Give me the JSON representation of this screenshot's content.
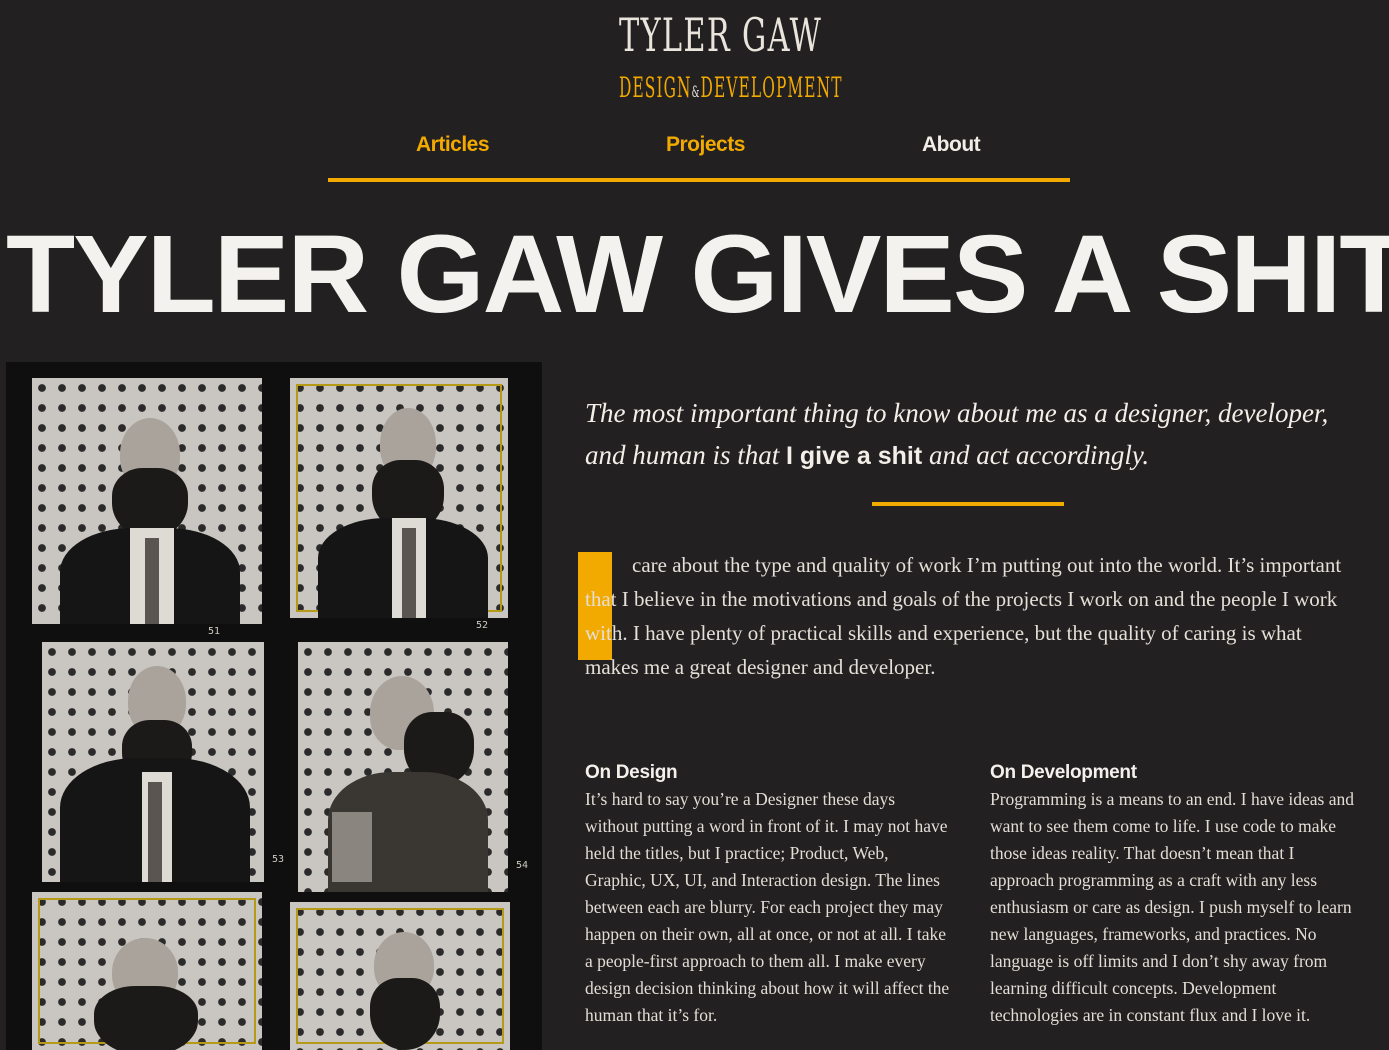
{
  "logo": {
    "line1": "TYLER GAW",
    "line2_left": "DESIGN",
    "amp": "&",
    "line2_right": "DEVELOPMENT"
  },
  "nav": {
    "items": [
      {
        "label": "Articles"
      },
      {
        "label": "Projects"
      },
      {
        "label": "About"
      }
    ]
  },
  "hero": {
    "title": "TYLER GAW GIVES A SHIT"
  },
  "photos": {
    "frame_numbers": [
      "51",
      "52",
      "53",
      "54"
    ]
  },
  "intro": {
    "before": "The most important thing to know about me as a designer, developer, and human is that ",
    "emphasis": "I give a shit",
    "after": " and act accordingly."
  },
  "body": {
    "paragraph": "care about the type and quality of work I’m putting out into the world. It’s important that I believe in the motivations and goals of the projects I work on and the people I work with. I have plenty of practical skills and experience, but the quality of caring is what makes me a great designer and developer."
  },
  "columns": {
    "design": {
      "heading": "On Design",
      "text": "It’s hard to say you’re a Designer these days without putting a word in front of it. I may not have held the titles, but I practice; Product, Web, Graphic, UX, UI, and Interaction design. The lines between each are blurry. For each project they may happen on their own, all at once, or not at all. I take a people-first approach to them all. I make every design decision thinking about how it will affect the human that it’s for."
    },
    "development": {
      "heading": "On Development",
      "text": "Programming is a means to an end. I have ideas and want to see them come to life. I use code to make those ideas reality. That doesn’t mean that I approach programming as a craft with any less enthusiasm or care as design. I push myself to learn new languages, frameworks, and practices. No language is off limits and I don’t shy away from learning difficult concepts. Development technologies are in constant flux and I love it."
    }
  },
  "colors": {
    "accent": "#f2a900",
    "background": "#222020",
    "text": "#e6e2dc"
  }
}
